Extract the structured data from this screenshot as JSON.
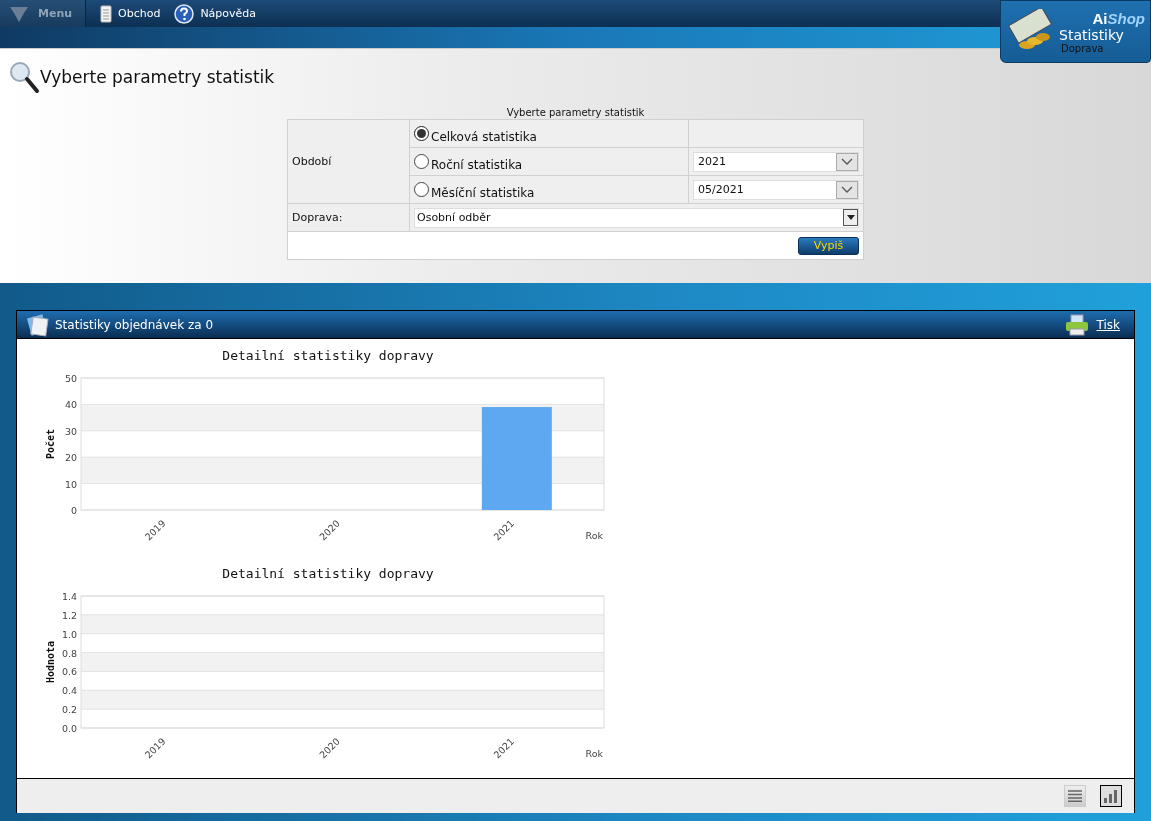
{
  "topbar": {
    "menu": "Menu",
    "items": [
      {
        "kind": "shop",
        "label": "Obchod"
      },
      {
        "kind": "help",
        "label": "Nápověda"
      }
    ]
  },
  "logo": {
    "brand_a": "Ai",
    "brand_b": "Shop",
    "title": "Statistiky",
    "subtitle": "Doprava"
  },
  "page_title": "Vyberte parametry statistik",
  "form": {
    "caption": "Vyberte parametry statistik",
    "period_label": "Období",
    "periods": [
      {
        "label": "Celková statistika",
        "selected": true
      },
      {
        "label": "Roční statistika",
        "selected": false,
        "select_value": "2021"
      },
      {
        "label": "Měsíční statistika",
        "selected": false,
        "select_value": "05/2021"
      }
    ],
    "transport_label": "Doprava:",
    "transport_value": "Osobní odběr",
    "submit": "Vypiš"
  },
  "panel": {
    "title": "Statistiky objednávek za 0",
    "print": "Tisk",
    "charts": [
      {
        "chart_data": {
          "type": "bar",
          "title": "Detailní statistiky dopravy",
          "xlabel": "Rok",
          "ylabel": "Počet",
          "categories": [
            "2019",
            "2020",
            "2021"
          ],
          "series": [
            {
              "color": "#5ea8f2",
              "values": [
                0,
                0,
                39
              ]
            }
          ],
          "grid": true,
          "ylim": [
            0,
            50
          ],
          "yticks": [
            0,
            10,
            20,
            30,
            40,
            50
          ]
        }
      },
      {
        "chart_data": {
          "type": "bar",
          "title": "Detailní statistiky dopravy",
          "xlabel": "Rok",
          "ylabel": "Hodnota",
          "categories": [
            "2019",
            "2020",
            "2021"
          ],
          "series": [
            {
              "values": [
                0,
                0,
                0
              ]
            }
          ],
          "grid": true,
          "ylim": [
            0,
            1.4
          ],
          "yticks": [
            {
              "value": 0,
              "label": "0.0"
            },
            {
              "value": 0.2,
              "label": "0.2"
            },
            {
              "value": 0.4,
              "label": "0.4"
            },
            {
              "value": 0.6,
              "label": "0.6"
            },
            {
              "value": 0.8,
              "label": "0.8"
            },
            {
              "value": 1,
              "label": "1.0"
            },
            {
              "value": 1.2,
              "label": "1.2"
            },
            {
              "value": 1.4,
              "label": "1.4"
            }
          ]
        }
      }
    ],
    "views": [
      {
        "kind": "table",
        "selected": false
      },
      {
        "kind": "chart",
        "selected": true
      }
    ]
  }
}
